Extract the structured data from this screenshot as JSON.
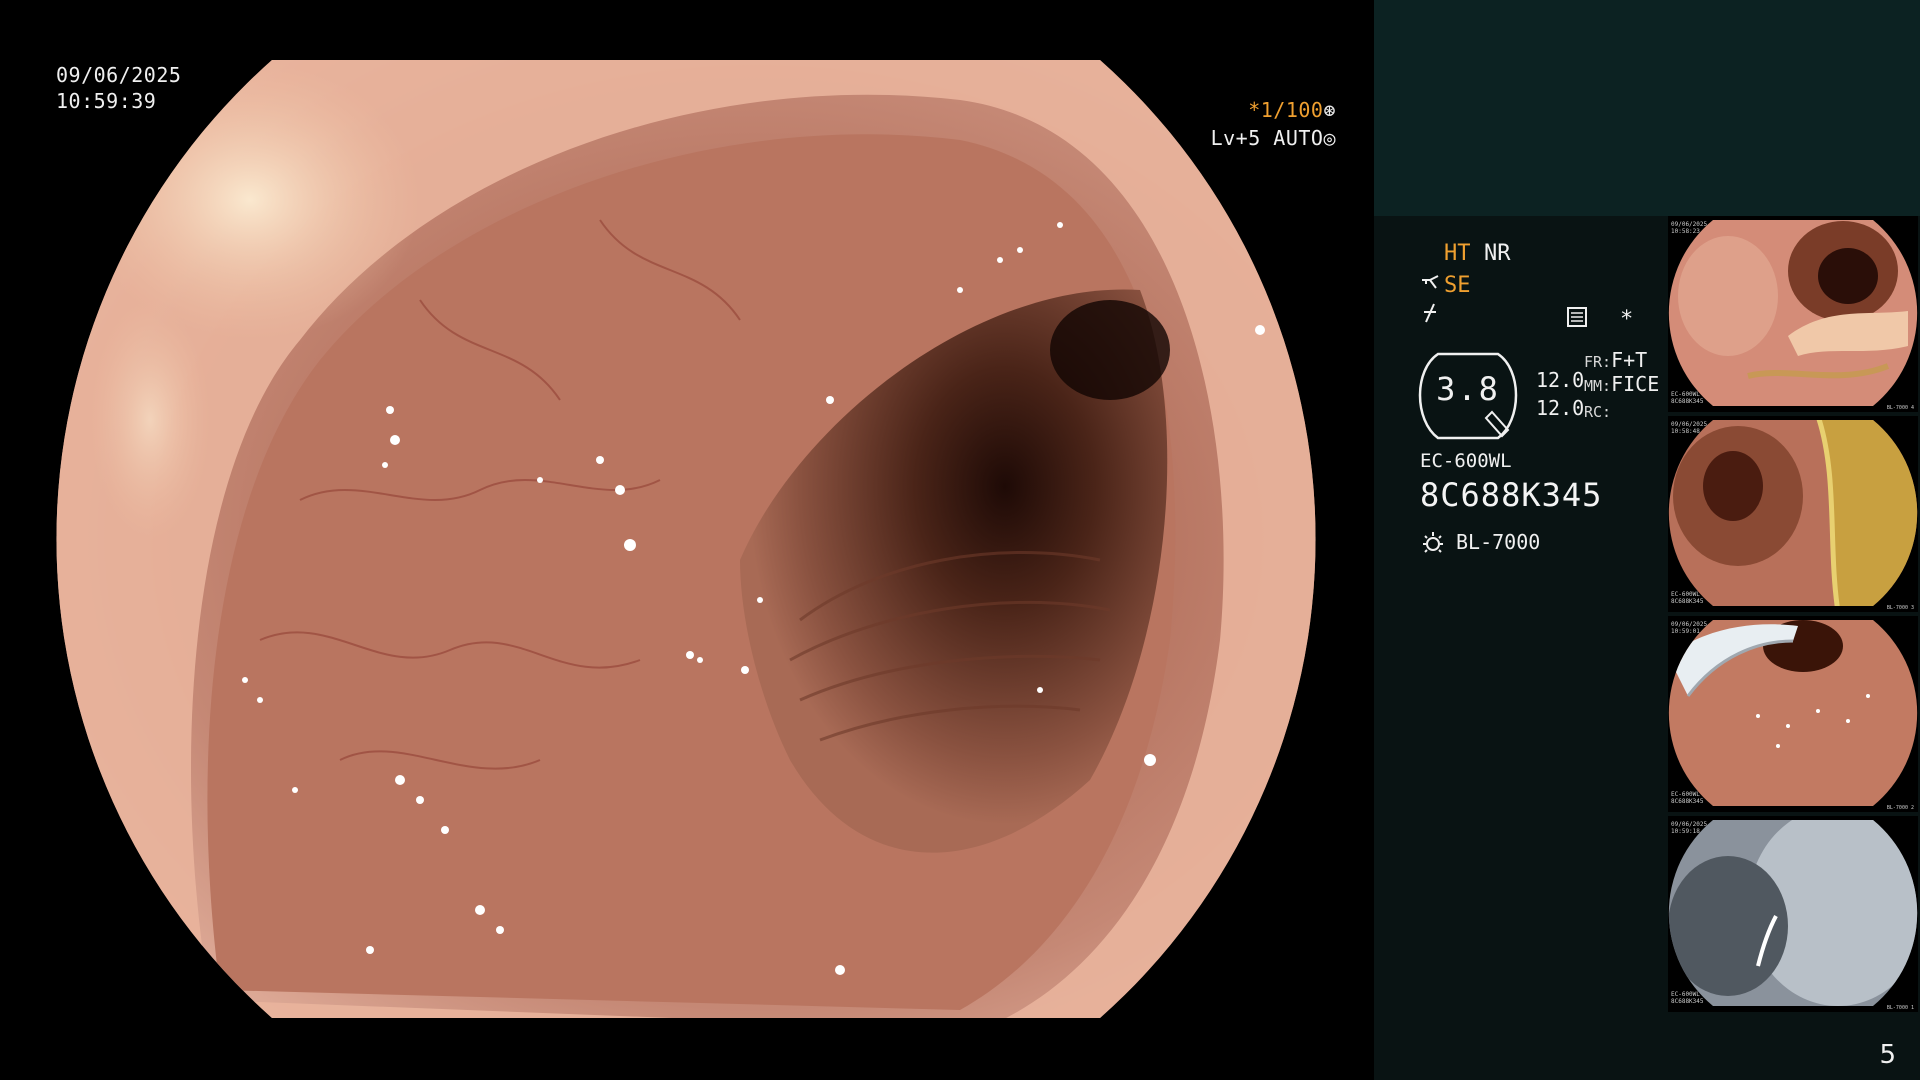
{
  "overlay": {
    "date": "09/06/2025",
    "time": "10:59:39",
    "shutter": "*1/100",
    "shutter_icon": "shutter-wheel-icon",
    "level": "Lv+5 AUTO",
    "level_icon": "auto-iris-icon"
  },
  "settings": {
    "ht": "HT",
    "nr": "NR",
    "se": "SE",
    "se_icon": "structure-enhance-icon",
    "function_icon": "function-slash-icon",
    "meter_icon": "meter-icon",
    "asterisk": "*",
    "gauge_value": "3.8",
    "val1": "12.0",
    "val2": "12.0",
    "fr_label": "FR:",
    "fr_value": "F+T",
    "mm_label": "MM:",
    "mm_value": "FICE",
    "rc_label": "RC:",
    "model": "EC-600WL",
    "serial": "8C688K345",
    "light_icon": "light-source-icon",
    "light_source": "BL-7000"
  },
  "thumbnails": [
    {
      "date": "09/06/2025",
      "time": "10:58:23",
      "model": "EC-600WL",
      "serial": "8C688K345",
      "light": "BL-7000",
      "index": "4"
    },
    {
      "date": "09/06/2025",
      "time": "10:58:48",
      "model": "EC-600WL",
      "serial": "8C688K345",
      "light": "BL-7000",
      "index": "3"
    },
    {
      "date": "09/06/2025",
      "time": "10:59:01",
      "model": "EC-600WL",
      "serial": "8C688K345",
      "light": "BL-7000",
      "index": "2"
    },
    {
      "date": "09/06/2025",
      "time": "10:59:18",
      "model": "EC-600WL",
      "serial": "8C688K345",
      "light": "BL-7000",
      "index": "1"
    }
  ],
  "page_number": "5",
  "colors": {
    "accent_orange": "#f0a030",
    "panel_bg": "#091313",
    "panel_header_bg": "#0c2222"
  }
}
